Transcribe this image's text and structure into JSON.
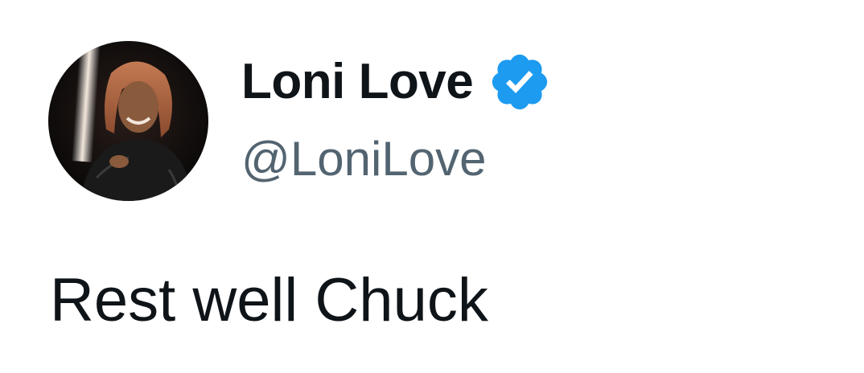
{
  "author": {
    "display_name": "Loni Love",
    "handle": "@LoniLove",
    "verified": true,
    "avatar_icon": "profile-photo"
  },
  "tweet": {
    "text": "Rest well Chuck"
  },
  "colors": {
    "text_primary": "#0f1419",
    "text_secondary": "#536471",
    "verified_blue": "#1d9bf0",
    "background": "#ffffff"
  }
}
